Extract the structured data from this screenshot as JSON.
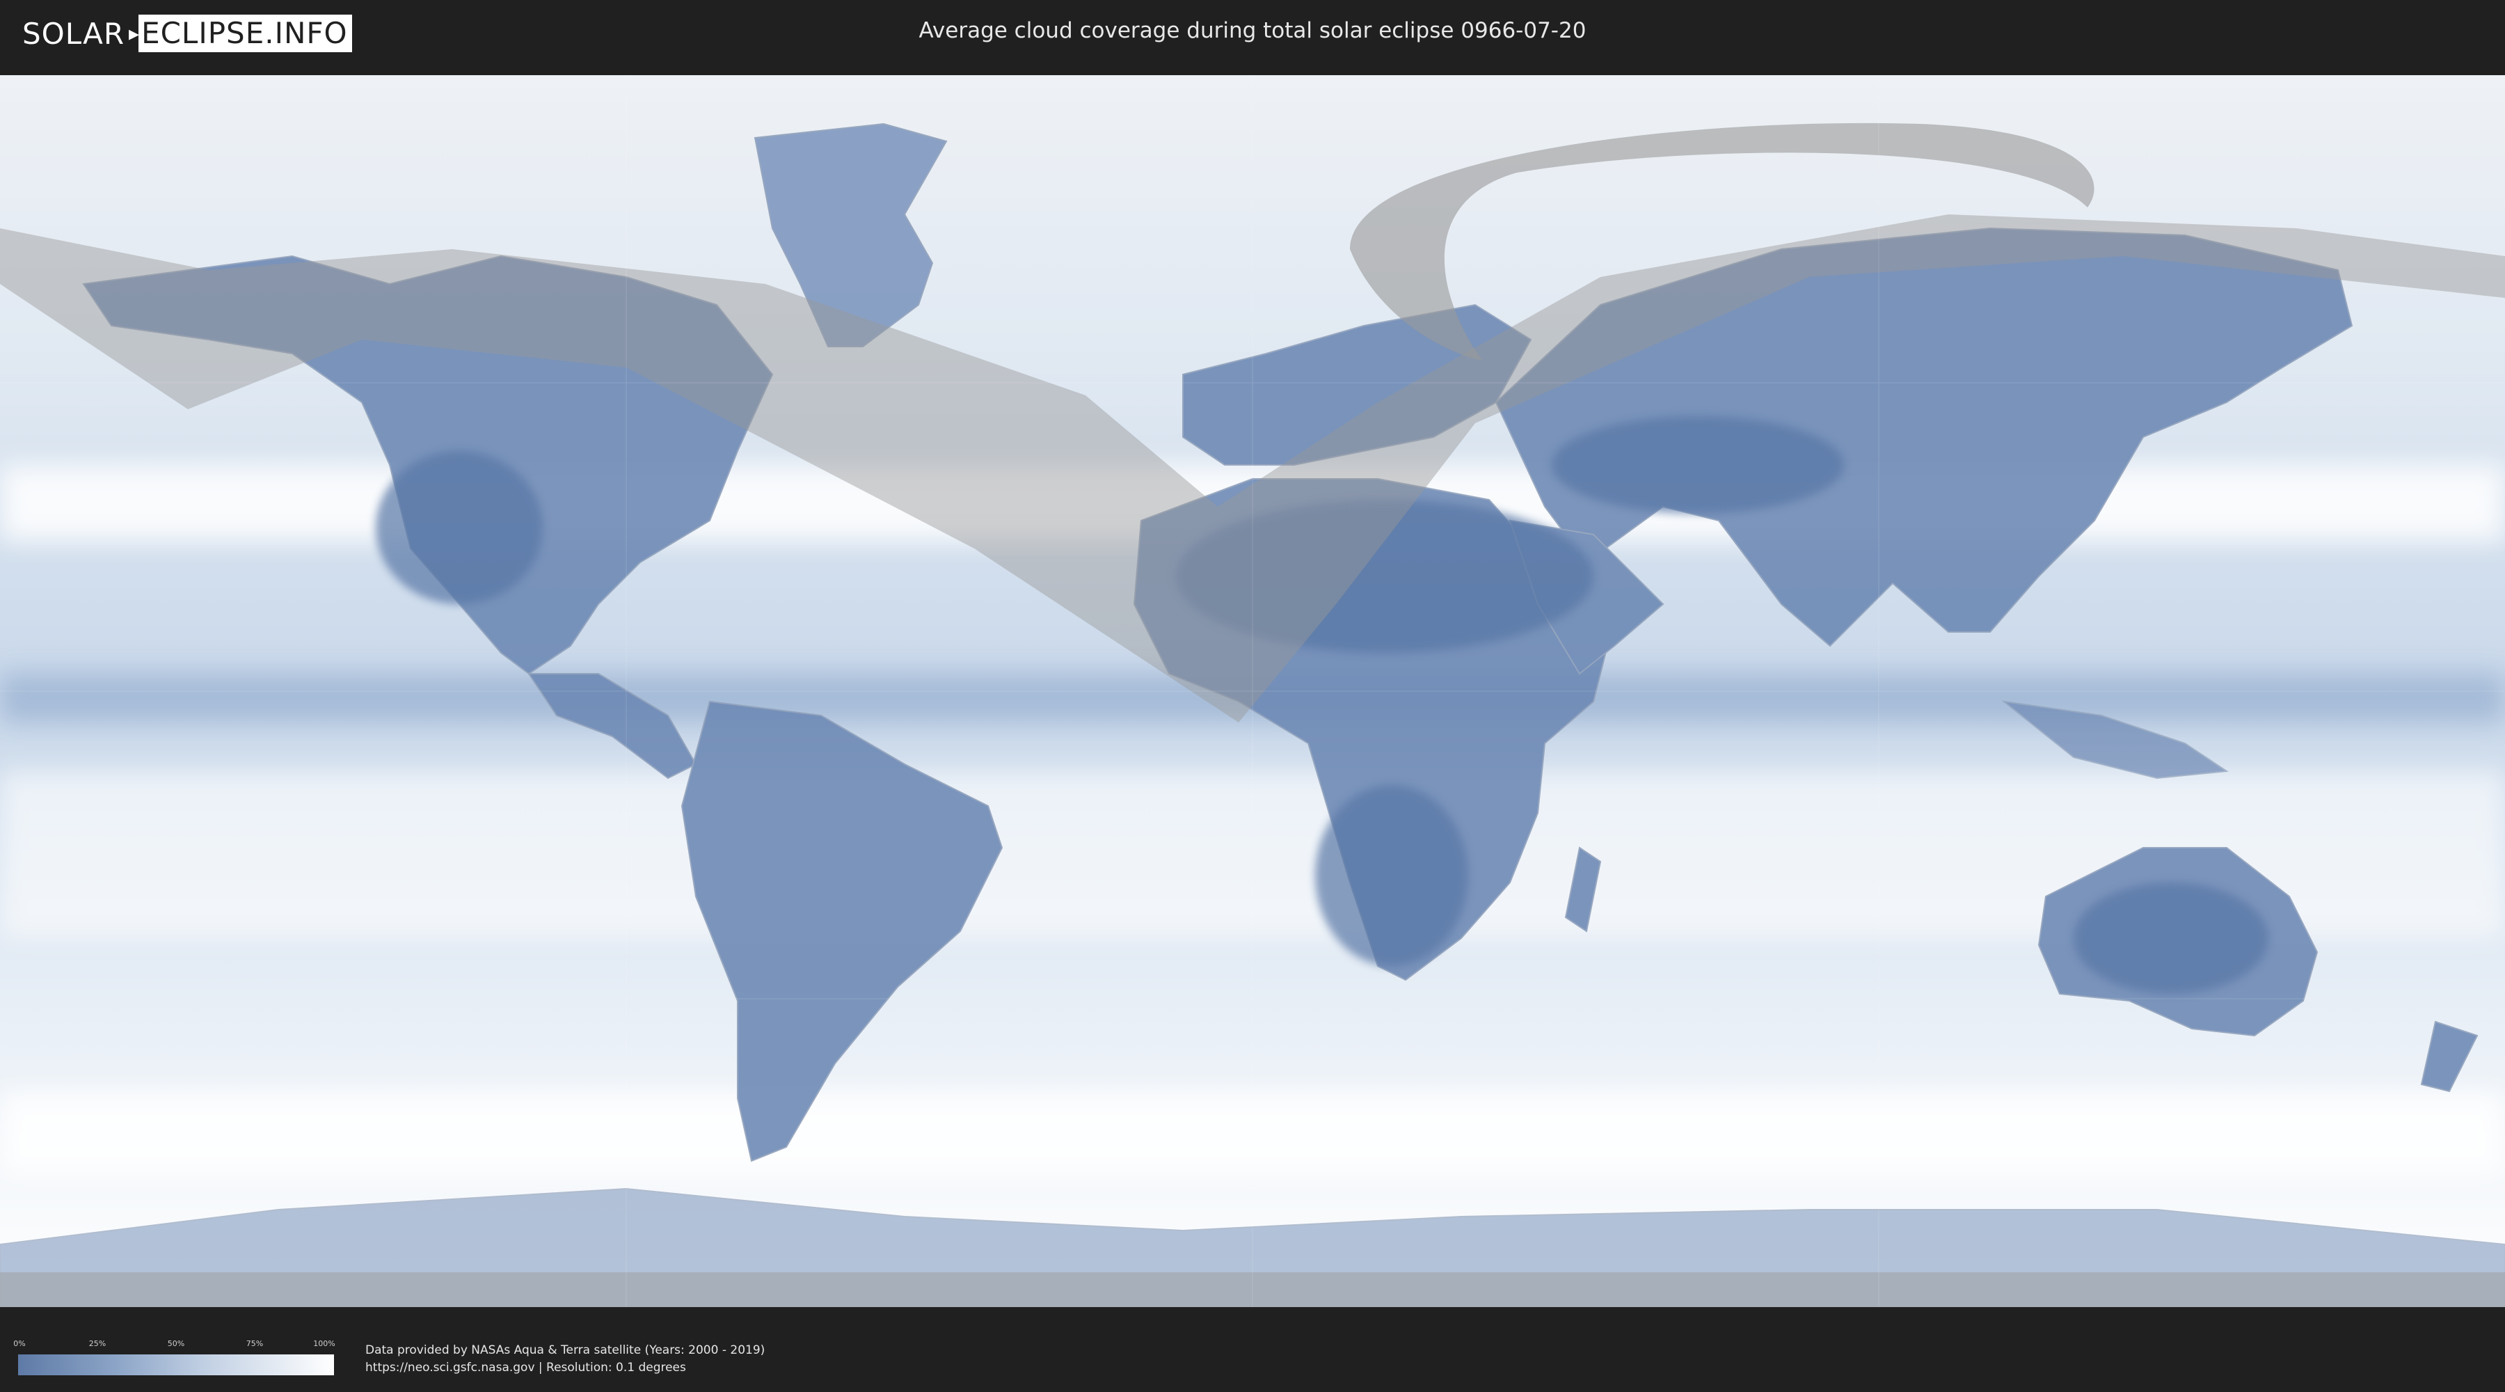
{
  "header": {
    "logo_left": "SOLAR",
    "logo_right": "ECLIPSE.INFO",
    "title": "Average cloud coverage during total solar eclipse 0966-07-20"
  },
  "legend": {
    "ticks": [
      "0%",
      "25%",
      "50%",
      "75%",
      "100%"
    ],
    "colors": {
      "low": "#5e7aa6",
      "high": "#ffffff"
    }
  },
  "footer": {
    "credit_line1": "Data provided by NASAs Aqua & Terra satellite (Years: 2000 - 2019)",
    "credit_line2": "https://neo.sci.gsfc.nasa.gov | Resolution: 0.1 degrees"
  },
  "map": {
    "land_color": "#5877a6",
    "cloud_color": "#f2f5f9",
    "shadow_color": "#9a9a9a"
  }
}
